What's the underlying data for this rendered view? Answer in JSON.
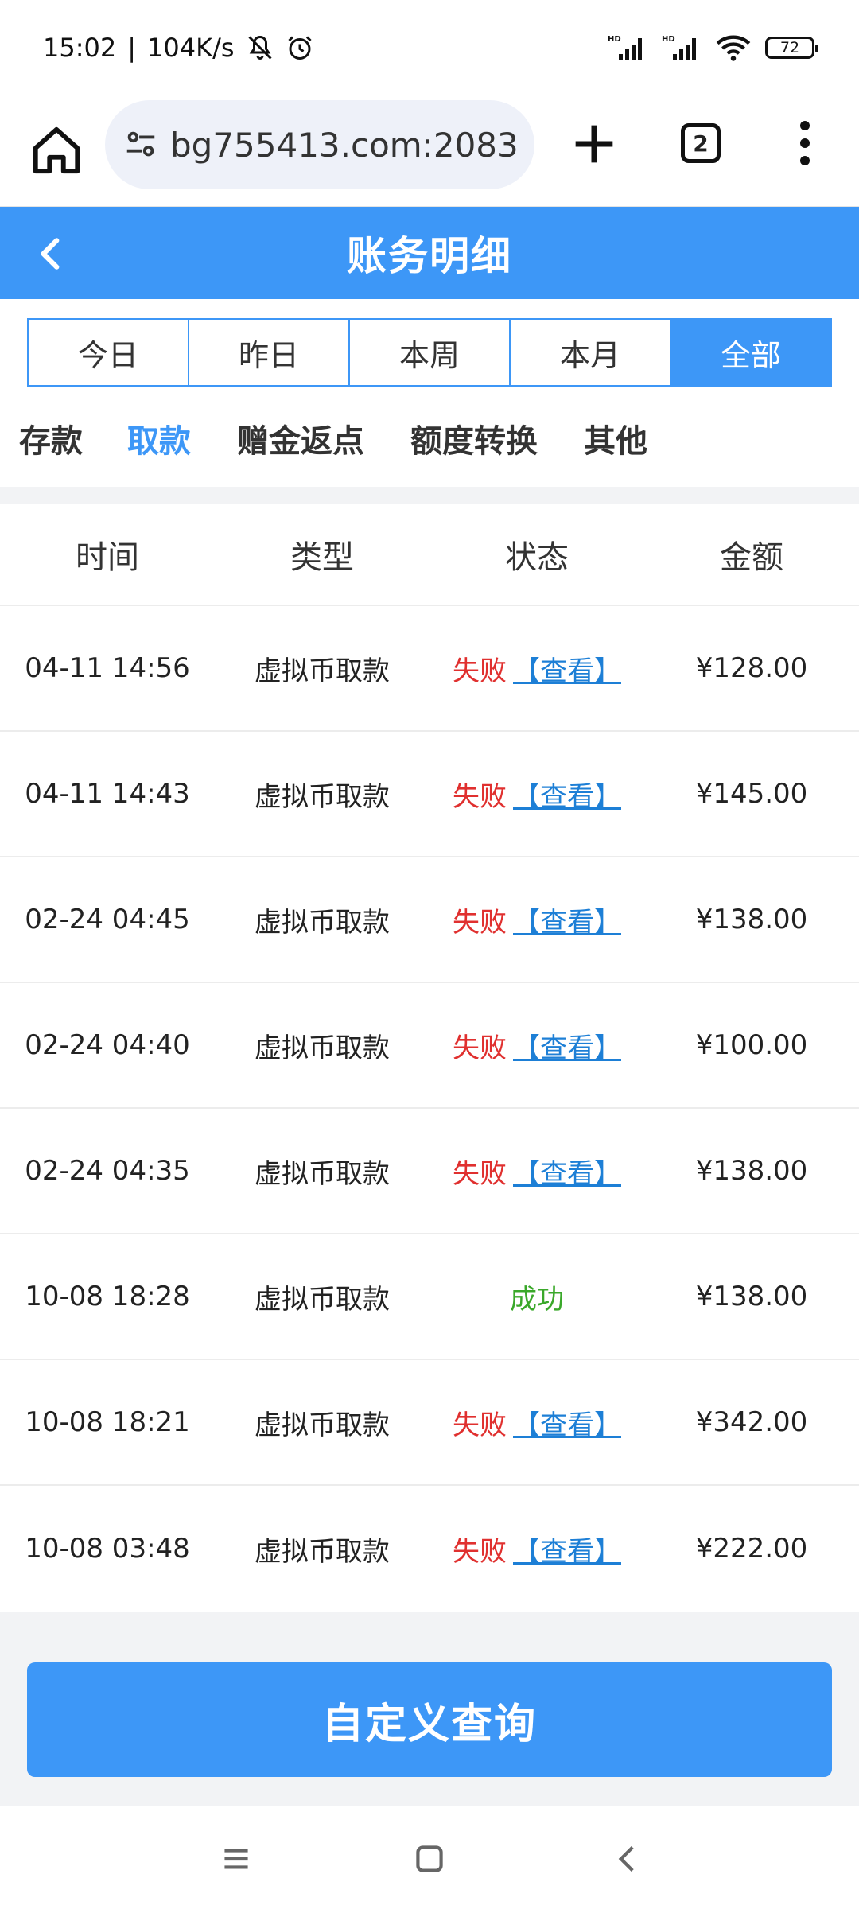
{
  "statusbar": {
    "time": "15:02",
    "sep": "|",
    "speed": "104K/s",
    "battery": "72"
  },
  "browser": {
    "url": "bg755413.com:2083",
    "tab_count": "2"
  },
  "header": {
    "title": "账务明细"
  },
  "period_tabs": [
    "今日",
    "昨日",
    "本周",
    "本月",
    "全部"
  ],
  "period_active": "全部",
  "category_tabs": [
    "存款",
    "取款",
    "赠金返点",
    "额度转换",
    "其他"
  ],
  "category_active": "取款",
  "table": {
    "headers": [
      "时间",
      "类型",
      "状态",
      "金额"
    ],
    "rows": [
      {
        "time": "04-11 14:56",
        "type": "虚拟币取款",
        "status": "失败",
        "view": "【查看】",
        "amount": "¥128.00"
      },
      {
        "time": "04-11 14:43",
        "type": "虚拟币取款",
        "status": "失败",
        "view": "【查看】",
        "amount": "¥145.00"
      },
      {
        "time": "02-24 04:45",
        "type": "虚拟币取款",
        "status": "失败",
        "view": "【查看】",
        "amount": "¥138.00"
      },
      {
        "time": "02-24 04:40",
        "type": "虚拟币取款",
        "status": "失败",
        "view": "【查看】",
        "amount": "¥100.00"
      },
      {
        "time": "02-24 04:35",
        "type": "虚拟币取款",
        "status": "失败",
        "view": "【查看】",
        "amount": "¥138.00"
      },
      {
        "time": "10-08 18:28",
        "type": "虚拟币取款",
        "status": "成功",
        "view": "",
        "amount": "¥138.00"
      },
      {
        "time": "10-08 18:21",
        "type": "虚拟币取款",
        "status": "失败",
        "view": "【查看】",
        "amount": "¥342.00"
      },
      {
        "time": "10-08 03:48",
        "type": "虚拟币取款",
        "status": "失败",
        "view": "【查看】",
        "amount": "¥222.00"
      }
    ]
  },
  "query_button": "自定义查询",
  "colors": {
    "primary": "#3d97f7",
    "fail": "#e0302f",
    "success": "#3aa82a",
    "link": "#1d7fd6"
  },
  "icons": {
    "status": [
      "mute-bell-icon",
      "alarm-icon",
      "signal-icon",
      "wifi-icon",
      "battery-icon"
    ],
    "browser": [
      "home-icon",
      "site-settings-icon",
      "plus-icon",
      "tabs-icon",
      "menu-dots-icon"
    ],
    "nav": [
      "recent-apps-icon",
      "home-nav-icon",
      "back-nav-icon"
    ]
  }
}
